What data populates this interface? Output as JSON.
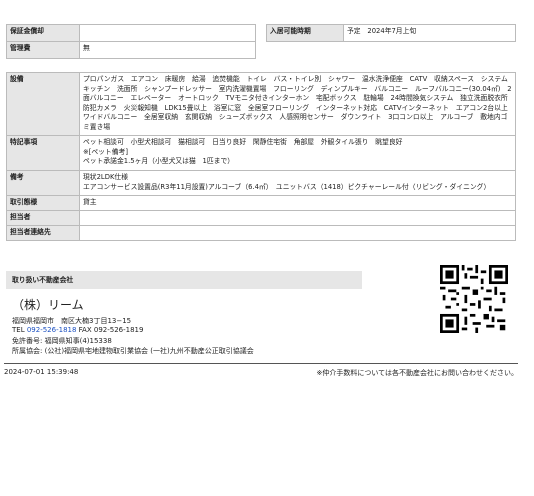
{
  "top_row": {
    "left_label": "保証金償却",
    "left_value": "",
    "right_label": "入居可能時期",
    "right_value": "予定　2024年7月上旬"
  },
  "rows": [
    {
      "label": "管理費",
      "value": "無"
    },
    {
      "label": "設備",
      "value": "プロパンガス　エアコン　床暖房　給湯　追焚機能　トイレ　バス・トイレ別　シャワー　温水洗浄便座　CATV　収納スペース　システムキッチン　洗面所　シャンプードレッサー　室内洗濯機置場　フローリング　ディンプルキー　バルコニー　ルーフバルコニー(30.04㎡)　2面バルコニー　エレベーター　オートロック　TVモニタ付きインターホン　宅配ボックス　駐輪場　24時間換気システム　独立洗面脱衣所　防犯カメラ　火災報知機　LDK15畳以上　浴室に窓　全居室フローリング　インターネット対応　CATVインターネット　エアコン2台以上　ワイドバルコニー　全居室収納　玄関収納　シューズボックス　人感照明センサー　ダウンライト　3口コンロ以上　アルコーブ　敷地内ゴミ置き場"
    },
    {
      "label": "特記事項",
      "value_lines": [
        "ペット相談可　小型犬相談可　猫相談可　日当り良好　閑静住宅街　角部屋　外観タイル張り　眺望良好",
        "※[ペット備考]",
        "ペット承諾金1.5ヶ月（小型犬又は猫　1匹まで）"
      ]
    },
    {
      "label": "備考",
      "value_lines": [
        "現状2LDK仕様",
        "エアコンサービス設置品(R3年11月設置)アルコーブ（6.4㎡）　ユニットバス（1418）ピクチャーレール付（リビング・ダイニング）"
      ]
    },
    {
      "label": "取引態様",
      "value": "貸主"
    },
    {
      "label": "担当者",
      "value": ""
    },
    {
      "label": "担当者連絡先",
      "value": ""
    }
  ],
  "agent": {
    "section_title": "取り扱い不動産会社",
    "company": "（株）リーム",
    "address": "福岡県福岡市　南区大楠3丁目13−15",
    "tel_label": "TEL",
    "tel": "092-526-1818",
    "fax_label": "FAX",
    "fax": "092-526-1819",
    "license": "免許番号: 福岡県知事(4)15338",
    "association": "所属協会: (公社)福岡県宅地建物取引業協会 (一社)九州不動産公正取引協議会"
  },
  "footer": {
    "timestamp": "2024-07-01 15:39:48",
    "note": "※仲介手数料については各不動産会社にお問い合わせください。"
  }
}
